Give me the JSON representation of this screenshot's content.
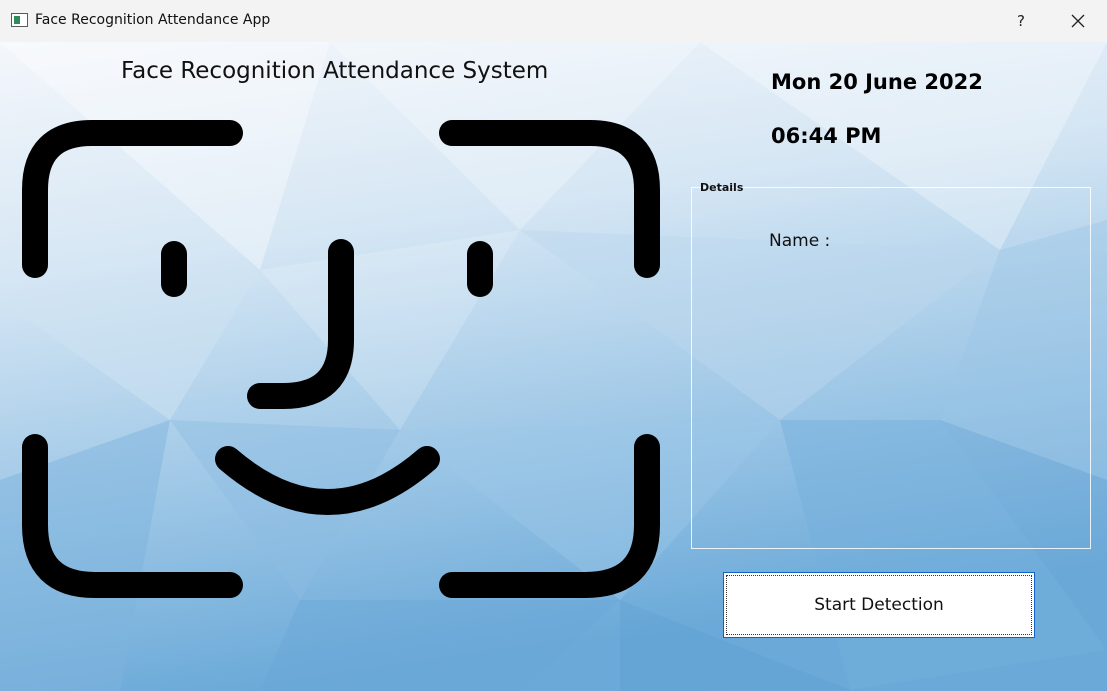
{
  "window": {
    "title": "Face Recognition Attendance App",
    "help_label": "?",
    "close_icon": "close-icon"
  },
  "main": {
    "heading": "Face Recognition Attendance System",
    "face_icon": "face-id-icon",
    "date": "Mon 20 June 2022",
    "time": "06:44 PM"
  },
  "details": {
    "legend": "Details",
    "name_label": "Name :",
    "name_value": ""
  },
  "actions": {
    "start_label": "Start Detection"
  },
  "colors": {
    "button_border": "#0f62c6",
    "background_light": "#eef3f9",
    "background_blue": "#6aa9d8"
  }
}
